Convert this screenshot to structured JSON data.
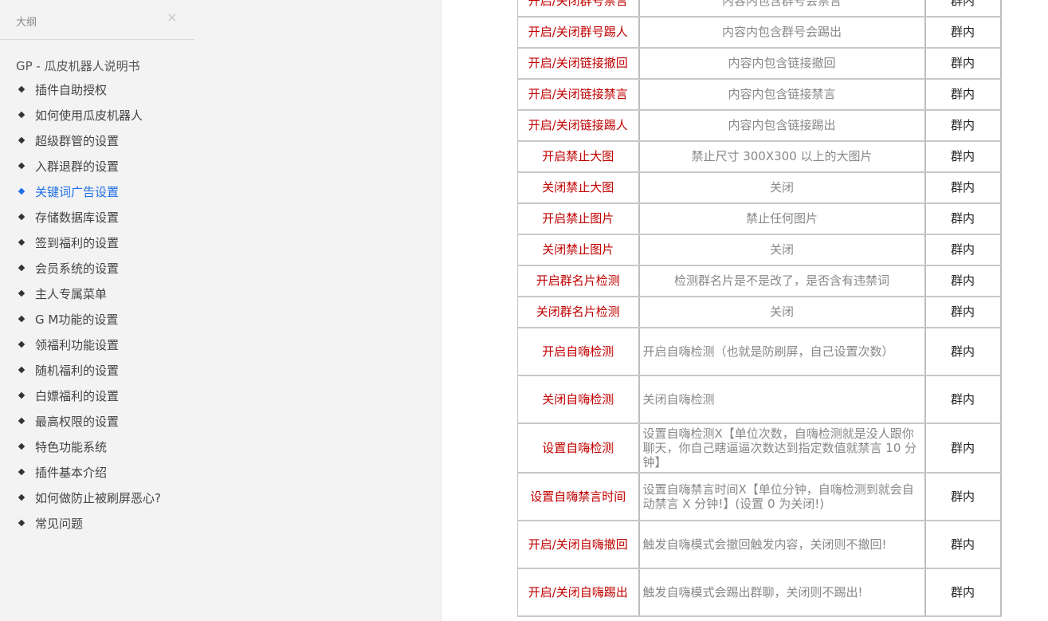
{
  "sidebar": {
    "title": "大纲",
    "close_glyph": "×",
    "root": "GP - 瓜皮机器人说明书",
    "items": [
      {
        "label": "插件自助授权"
      },
      {
        "label": "如何使用瓜皮机器人"
      },
      {
        "label": "超级群管的设置"
      },
      {
        "label": "入群退群的设置"
      },
      {
        "label": "关键词广告设置",
        "active": true
      },
      {
        "label": "存储数据库设置"
      },
      {
        "label": "签到福利的设置"
      },
      {
        "label": "会员系统的设置"
      },
      {
        "label": "主人专属菜单"
      },
      {
        "label": "G M功能的设置"
      },
      {
        "label": "领福利功能设置"
      },
      {
        "label": "随机福利的设置"
      },
      {
        "label": "白嫖福利的设置"
      },
      {
        "label": "最高权限的设置"
      },
      {
        "label": "特色功能系统"
      },
      {
        "label": "插件基本介绍"
      },
      {
        "label": "如何做防止被刷屏恶心?"
      },
      {
        "label": "常见问题"
      }
    ]
  },
  "table": {
    "rows": [
      {
        "cmd": "开启/关闭群号禁言",
        "desc": "内容内包含群号会禁言",
        "scope": "群内"
      },
      {
        "cmd": "开启/关闭群号踢人",
        "desc": "内容内包含群号会踢出",
        "scope": "群内"
      },
      {
        "cmd": "开启/关闭链接撤回",
        "desc": "内容内包含链接撤回",
        "scope": "群内"
      },
      {
        "cmd": "开启/关闭链接禁言",
        "desc": "内容内包含链接禁言",
        "scope": "群内"
      },
      {
        "cmd": "开启/关闭链接踢人",
        "desc": "内容内包含链接踢出",
        "scope": "群内"
      },
      {
        "cmd": "开启禁止大图",
        "desc": "禁止尺寸 300X300 以上的大图片",
        "scope": "群内"
      },
      {
        "cmd": "关闭禁止大图",
        "desc": "关闭",
        "scope": "群内"
      },
      {
        "cmd": "开启禁止图片",
        "desc": "禁止任何图片",
        "scope": "群内"
      },
      {
        "cmd": "关闭禁止图片",
        "desc": "关闭",
        "scope": "群内"
      },
      {
        "cmd": "开启群名片检测",
        "desc": "检测群名片是不是改了，是否含有违禁词",
        "scope": "群内"
      },
      {
        "cmd": "关闭群名片检测",
        "desc": "关闭",
        "scope": "群内"
      },
      {
        "cmd": "开启自嗨检测",
        "desc": "开启自嗨检测（也就是防刷屏，自己设置次数）",
        "scope": "群内",
        "tall": true,
        "left": true
      },
      {
        "cmd": "关闭自嗨检测",
        "desc": "关闭自嗨检测",
        "scope": "群内",
        "tall": true,
        "left": true
      },
      {
        "cmd": "设置自嗨检测",
        "desc": "设置自嗨检测X【单位次数，自嗨检测就是没人跟你聊天，你自己瞎逼逼次数达到指定数值就禁言 10 分钟】",
        "scope": "群内",
        "tall": true,
        "left": true
      },
      {
        "cmd": "设置自嗨禁言时间",
        "desc": "设置自嗨禁言时间X【单位分钟，自嗨检测到就会自动禁言 X 分钟!】(设置 0 为关闭!)",
        "scope": "群内",
        "tall": true,
        "left": true
      },
      {
        "cmd": "开启/关闭自嗨撤回",
        "desc": "触发自嗨模式会撤回触发内容，关闭则不撤回!",
        "scope": "群内",
        "tall": true,
        "left": true
      },
      {
        "cmd": "开启/关闭自嗨踢出",
        "desc": "触发自嗨模式会踢出群聊，关闭则不踢出!",
        "scope": "群内",
        "tall": true,
        "left": true
      }
    ]
  }
}
